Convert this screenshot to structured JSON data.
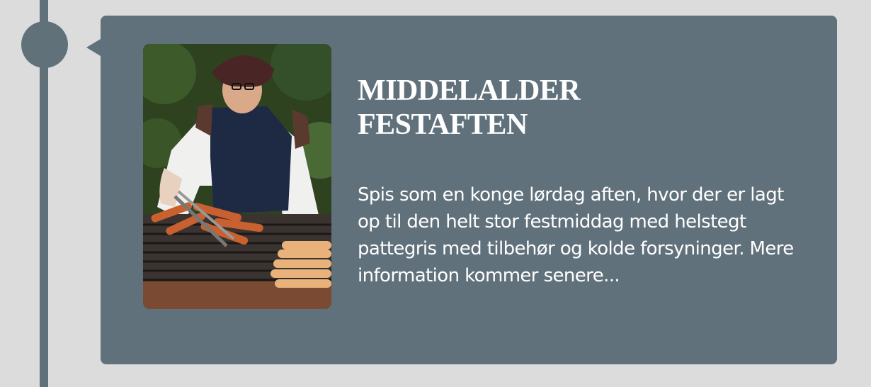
{
  "event": {
    "title": "MIDDELALDER FESTAFTEN",
    "description": "Spis som en konge lørdag aften, hvor der er lagt op til den helt stor festmiddag med helstegt pattegris med tilbehør og kolde forsyninger. Mere information kommer senere...",
    "image_subject": "Man in medieval costume grilling sausages on a barbecue"
  },
  "colors": {
    "background": "#dcdcdc",
    "timeline": "#607179",
    "card": "#61717b",
    "text": "#ffffff"
  }
}
